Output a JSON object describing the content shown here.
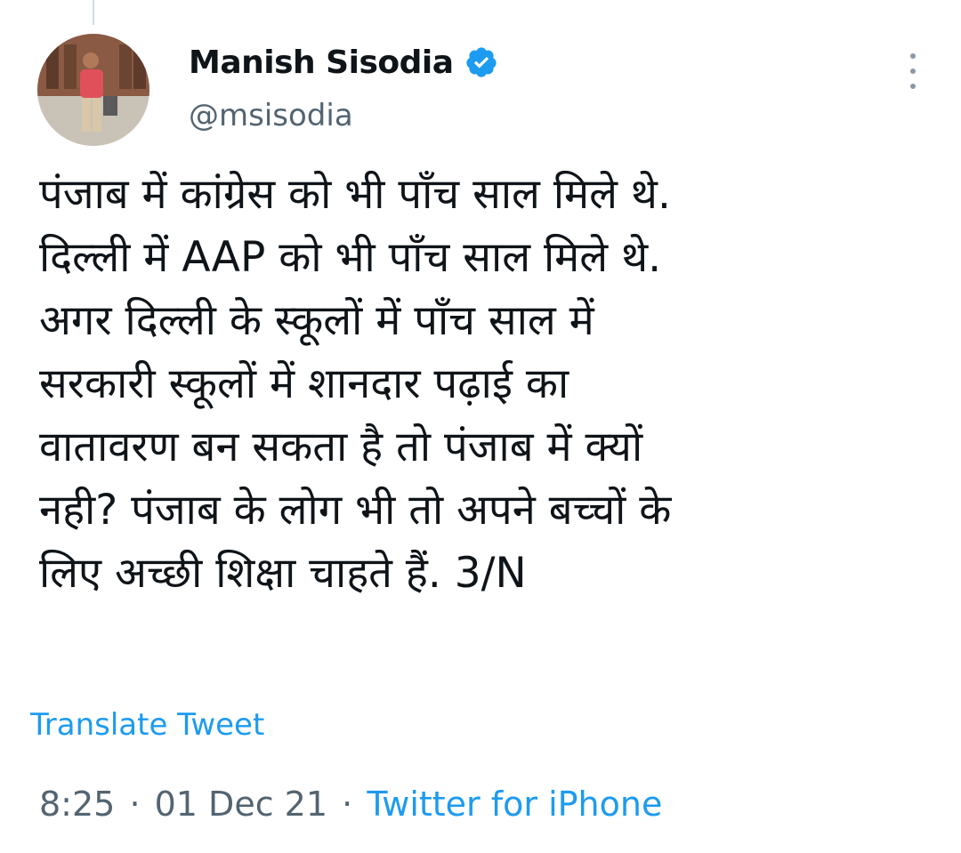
{
  "author": {
    "display_name": "Manish Sisodia",
    "handle": "@msisodia",
    "verified": true,
    "verified_icon": "verified-badge-icon",
    "verified_color": "#1d9bf0"
  },
  "tweet": {
    "lines": [
      "पंजाब में कांग्रेस को भी पाँच साल मिले थे.",
      "दिल्ली में AAP को भी पाँच साल मिले थे.",
      "अगर दिल्ली के स्कूलों में पाँच साल में",
      "सरकारी स्कूलों में शानदार पढ़ाई का",
      "वातावरण बन सकता है तो पंजाब में क्यों",
      "नही? पंजाब के लोग भी तो अपने बच्चों के",
      "लिए अच्छी शिक्षा चाहते हैं.  3/N"
    ]
  },
  "translate_label": "Translate Tweet",
  "meta": {
    "time": "8:25",
    "separator": "·",
    "date": "01 Dec 21",
    "source": "Twitter for iPhone"
  },
  "colors": {
    "link": "#1d9bf0",
    "secondary_text": "#536471",
    "primary_text": "#0f1419"
  },
  "icons": {
    "more": "more-options-icon"
  }
}
